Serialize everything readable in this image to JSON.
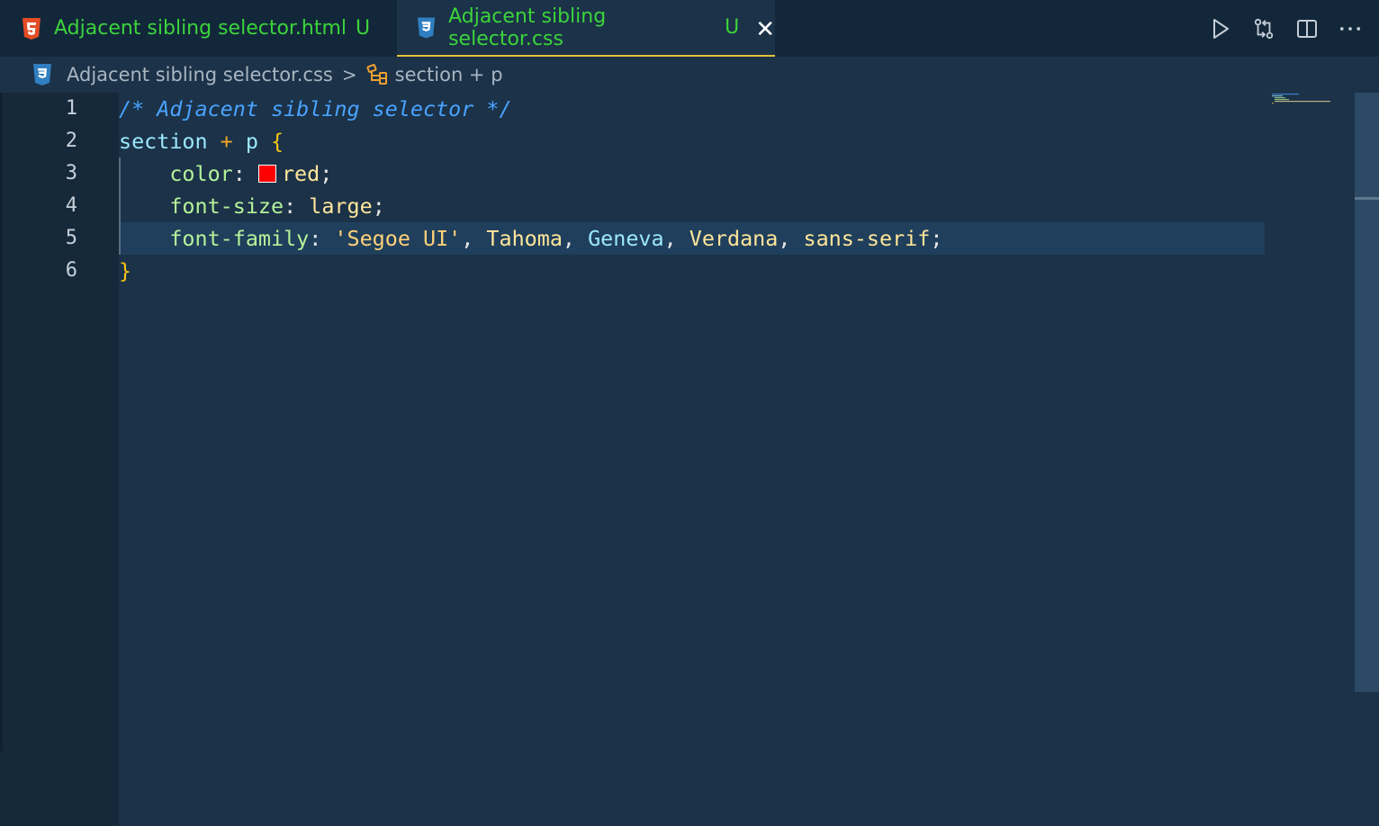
{
  "tabs": [
    {
      "filename": "Adjacent sibling selector.html",
      "status": "U",
      "icon": "html5-icon"
    },
    {
      "filename": "Adjacent sibling selector.css",
      "status": "U",
      "icon": "css3-icon",
      "close": "✕"
    }
  ],
  "actions": [
    "run-icon",
    "compare-changes-icon",
    "split-editor-icon",
    "more-actions-icon"
  ],
  "breadcrumb": {
    "file": "Adjacent sibling selector.css",
    "separator": ">",
    "symbol": "section + p"
  },
  "editor": {
    "line_numbers": [
      "1",
      "2",
      "3",
      "4",
      "5",
      "6"
    ],
    "current_line": 5,
    "code": {
      "l1_comment": "/* Adjacent sibling selector */",
      "l2_sel1": "section",
      "l2_op": "+",
      "l2_sel2": "p",
      "l2_brace": "{",
      "l3_prop": "color",
      "l3_colon": ": ",
      "l3_val": "red",
      "l3_semi": ";",
      "l4_prop": "font-size",
      "l4_colon": ": ",
      "l4_val": "large",
      "l4_semi": ";",
      "l5_prop": "font-family",
      "l5_colon": ": ",
      "l5_v1": "'Segoe UI'",
      "l5_c1": ", ",
      "l5_v2": "Tahoma",
      "l5_c2": ", ",
      "l5_v3": "Geneva",
      "l5_c3": ", ",
      "l5_v4": "Verdana",
      "l5_c4": ", ",
      "l5_v5": "sans-serif",
      "l5_semi": ";",
      "l6_brace": "}"
    },
    "swatch_color": "#ff0000"
  },
  "colors": {
    "background": "#1b3248",
    "tab_text": "#3cd33c",
    "active_tab_border": "#e2c23a"
  }
}
